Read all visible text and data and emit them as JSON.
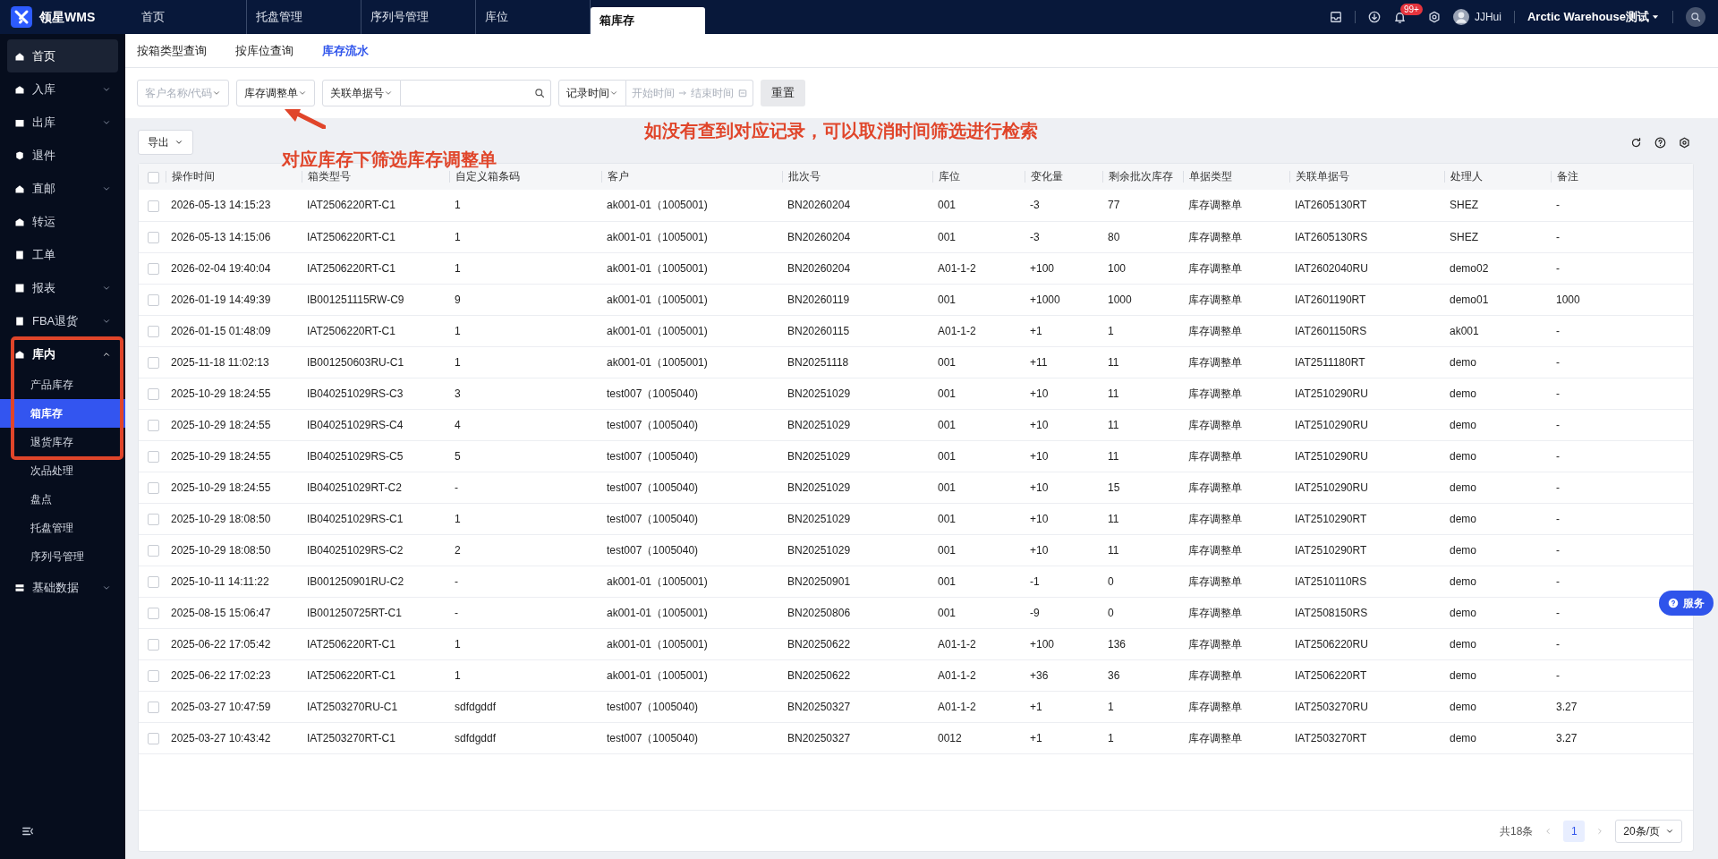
{
  "app": {
    "name": "领星WMS"
  },
  "top_tabs": [
    {
      "label": "首页",
      "selected": false
    },
    {
      "label": "托盘管理",
      "selected": false
    },
    {
      "label": "序列号管理",
      "selected": false
    },
    {
      "label": "库位",
      "selected": false
    },
    {
      "label": "箱库存",
      "selected": true
    }
  ],
  "top_bar": {
    "notification_badge": "99+",
    "user": "JJHui",
    "warehouse": "Arctic Warehouse测试"
  },
  "sidebar": {
    "items": [
      {
        "label": "首页",
        "kind": "link",
        "highlighted": true
      },
      {
        "label": "入库",
        "kind": "group",
        "expanded": false,
        "highlighted": false
      },
      {
        "label": "出库",
        "kind": "group",
        "expanded": false,
        "highlighted": false
      },
      {
        "label": "退件",
        "kind": "link",
        "highlighted": false
      },
      {
        "label": "直邮",
        "kind": "group",
        "expanded": false,
        "highlighted": false
      },
      {
        "label": "转运",
        "kind": "link",
        "highlighted": false
      },
      {
        "label": "工单",
        "kind": "link",
        "highlighted": false
      },
      {
        "label": "报表",
        "kind": "group",
        "expanded": false,
        "highlighted": false
      },
      {
        "label": "FBA退货",
        "kind": "group",
        "expanded": false,
        "highlighted": false
      },
      {
        "label": "库内",
        "kind": "group",
        "expanded": true,
        "highlighted": false,
        "children": [
          {
            "label": "产品库存",
            "selected": false
          },
          {
            "label": "箱库存",
            "selected": true
          },
          {
            "label": "退货库存",
            "selected": false
          },
          {
            "label": "次品处理",
            "selected": false
          },
          {
            "label": "盘点",
            "selected": false
          },
          {
            "label": "托盘管理",
            "selected": false
          },
          {
            "label": "序列号管理",
            "selected": false
          }
        ]
      },
      {
        "label": "基础数据",
        "kind": "group",
        "expanded": false,
        "highlighted": false
      }
    ]
  },
  "sub_tabs": [
    {
      "label": "按箱类型查询",
      "selected": false
    },
    {
      "label": "按库位查询",
      "selected": false
    },
    {
      "label": "库存流水",
      "selected": true
    }
  ],
  "filters": {
    "customer": {
      "placeholder": "客户名称/代码"
    },
    "document_type": {
      "value": "库存调整单"
    },
    "related_field": {
      "value": "关联单据号"
    },
    "time_field": {
      "value": "记录时间"
    },
    "date_range": {
      "start_placeholder": "开始时间",
      "end_placeholder": "结束时间"
    },
    "reset_button": "重置"
  },
  "toolbar": {
    "export_button": "导出"
  },
  "table": {
    "header_checked": false,
    "columns": [
      "操作时间",
      "箱类型号",
      "自定义箱条码",
      "客户",
      "批次号",
      "库位",
      "变化量",
      "剩余批次库存",
      "单据类型",
      "关联单据号",
      "处理人",
      "备注"
    ],
    "rows": [
      {
        "checked": false,
        "cells": [
          "2026-05-13 14:15:23",
          "IAT2506220RT-C1",
          "1",
          "ak001-01（1005001)",
          "BN20260204",
          "001",
          "-3",
          "77",
          "库存调整单",
          "IAT2605130RT",
          "SHEZ",
          "-"
        ]
      },
      {
        "checked": false,
        "cells": [
          "2026-05-13 14:15:06",
          "IAT2506220RT-C1",
          "1",
          "ak001-01（1005001)",
          "BN20260204",
          "001",
          "-3",
          "80",
          "库存调整单",
          "IAT2605130RS",
          "SHEZ",
          "-"
        ]
      },
      {
        "checked": false,
        "cells": [
          "2026-02-04 19:40:04",
          "IAT2506220RT-C1",
          "1",
          "ak001-01（1005001)",
          "BN20260204",
          "A01-1-2",
          "+100",
          "100",
          "库存调整单",
          "IAT2602040RU",
          "demo02",
          "-"
        ]
      },
      {
        "checked": false,
        "cells": [
          "2026-01-19 14:49:39",
          "IB001251115RW-C9",
          "9",
          "ak001-01（1005001)",
          "BN20260119",
          "001",
          "+1000",
          "1000",
          "库存调整单",
          "IAT2601190RT",
          "demo01",
          "1000"
        ]
      },
      {
        "checked": false,
        "cells": [
          "2026-01-15 01:48:09",
          "IAT2506220RT-C1",
          "1",
          "ak001-01（1005001)",
          "BN20260115",
          "A01-1-2",
          "+1",
          "1",
          "库存调整单",
          "IAT2601150RS",
          "ak001",
          "-"
        ]
      },
      {
        "checked": false,
        "cells": [
          "2025-11-18 11:02:13",
          "IB001250603RU-C1",
          "1",
          "ak001-01（1005001)",
          "BN20251118",
          "001",
          "+11",
          "11",
          "库存调整单",
          "IAT2511180RT",
          "demo",
          "-"
        ]
      },
      {
        "checked": false,
        "cells": [
          "2025-10-29 18:24:55",
          "IB040251029RS-C3",
          "3",
          "test007（1005040)",
          "BN20251029",
          "001",
          "+10",
          "11",
          "库存调整单",
          "IAT2510290RU",
          "demo",
          "-"
        ]
      },
      {
        "checked": false,
        "cells": [
          "2025-10-29 18:24:55",
          "IB040251029RS-C4",
          "4",
          "test007（1005040)",
          "BN20251029",
          "001",
          "+10",
          "11",
          "库存调整单",
          "IAT2510290RU",
          "demo",
          "-"
        ]
      },
      {
        "checked": false,
        "cells": [
          "2025-10-29 18:24:55",
          "IB040251029RS-C5",
          "5",
          "test007（1005040)",
          "BN20251029",
          "001",
          "+10",
          "11",
          "库存调整单",
          "IAT2510290RU",
          "demo",
          "-"
        ]
      },
      {
        "checked": false,
        "cells": [
          "2025-10-29 18:24:55",
          "IB040251029RT-C2",
          "-",
          "test007（1005040)",
          "BN20251029",
          "001",
          "+10",
          "15",
          "库存调整单",
          "IAT2510290RU",
          "demo",
          "-"
        ]
      },
      {
        "checked": false,
        "cells": [
          "2025-10-29 18:08:50",
          "IB040251029RS-C1",
          "1",
          "test007（1005040)",
          "BN20251029",
          "001",
          "+10",
          "11",
          "库存调整单",
          "IAT2510290RT",
          "demo",
          "-"
        ]
      },
      {
        "checked": false,
        "cells": [
          "2025-10-29 18:08:50",
          "IB040251029RS-C2",
          "2",
          "test007（1005040)",
          "BN20251029",
          "001",
          "+10",
          "11",
          "库存调整单",
          "IAT2510290RT",
          "demo",
          "-"
        ]
      },
      {
        "checked": false,
        "cells": [
          "2025-10-11 14:11:22",
          "IB001250901RU-C2",
          "-",
          "ak001-01（1005001)",
          "BN20250901",
          "001",
          "-1",
          "0",
          "库存调整单",
          "IAT2510110RS",
          "demo",
          "-"
        ]
      },
      {
        "checked": false,
        "cells": [
          "2025-08-15 15:06:47",
          "IB001250725RT-C1",
          "-",
          "ak001-01（1005001)",
          "BN20250806",
          "001",
          "-9",
          "0",
          "库存调整单",
          "IAT2508150RS",
          "demo",
          "-"
        ]
      },
      {
        "checked": false,
        "cells": [
          "2025-06-22 17:05:42",
          "IAT2506220RT-C1",
          "1",
          "ak001-01（1005001)",
          "BN20250622",
          "A01-1-2",
          "+100",
          "136",
          "库存调整单",
          "IAT2506220RU",
          "demo",
          "-"
        ]
      },
      {
        "checked": false,
        "cells": [
          "2025-06-22 17:02:23",
          "IAT2506220RT-C1",
          "1",
          "ak001-01（1005001)",
          "BN20250622",
          "A01-1-2",
          "+36",
          "36",
          "库存调整单",
          "IAT2506220RT",
          "demo",
          "-"
        ]
      },
      {
        "checked": false,
        "cells": [
          "2025-03-27 10:47:59",
          "IAT2503270RU-C1",
          "sdfdgddf",
          "test007（1005040)",
          "BN20250327",
          "A01-1-2",
          "+1",
          "1",
          "库存调整单",
          "IAT2503270RU",
          "demo",
          "3.27"
        ]
      },
      {
        "checked": false,
        "cells": [
          "2025-03-27 10:43:42",
          "IAT2503270RT-C1",
          "sdfdgddf",
          "test007（1005040)",
          "BN20250327",
          "0012",
          "+1",
          "1",
          "库存调整单",
          "IAT2503270RT",
          "demo",
          "3.27"
        ]
      }
    ]
  },
  "pagination": {
    "total": "共18条",
    "pages": [
      {
        "label": "1",
        "selected": true
      }
    ],
    "page_size": "20条/页"
  },
  "service_button": "服务",
  "annotations": [
    {
      "kind": "arrow-note",
      "text": "对应库存下筛选库存调整单"
    },
    {
      "kind": "note",
      "text": "如没有查到对应记录，可以取消时间筛选进行检索"
    },
    {
      "kind": "highlight-box"
    }
  ]
}
